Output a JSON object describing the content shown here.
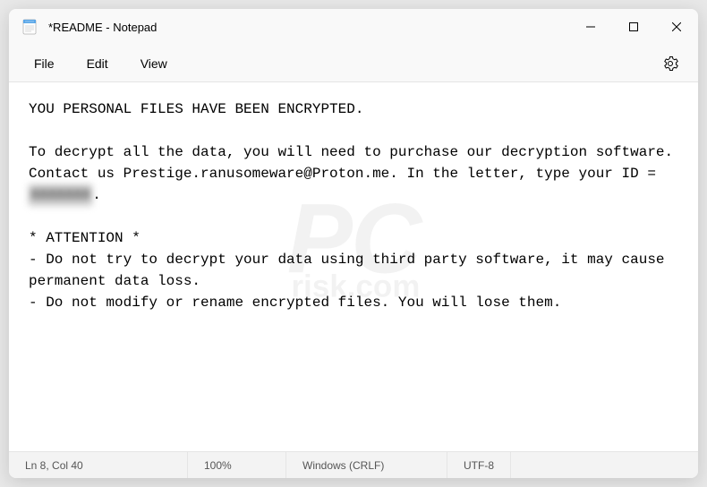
{
  "titlebar": {
    "title": "*README - Notepad"
  },
  "menu": {
    "file": "File",
    "edit": "Edit",
    "view": "View"
  },
  "content": {
    "line1": "YOU PERSONAL FILES HAVE BEEN ENCRYPTED.",
    "line2": "",
    "line3": "To decrypt all the data, you will need to purchase our decryption software.",
    "line4_part1": "Contact us Prestige.ranusomeware@Proton.me. In the letter, type your ID = ",
    "line4_blurred": "XXXXXXX",
    "line4_part2": ".",
    "line5": "",
    "line6": "* ATTENTION *",
    "line7": "- Do not try to decrypt your data using third party software, it may cause permanent data loss.",
    "line8": "- Do not modify or rename encrypted files. You will lose them."
  },
  "statusbar": {
    "position": "Ln 8, Col 40",
    "zoom": "100%",
    "line_ending": "Windows (CRLF)",
    "encoding": "UTF-8"
  },
  "watermark": {
    "main": "PC",
    "sub": "risk.com"
  }
}
